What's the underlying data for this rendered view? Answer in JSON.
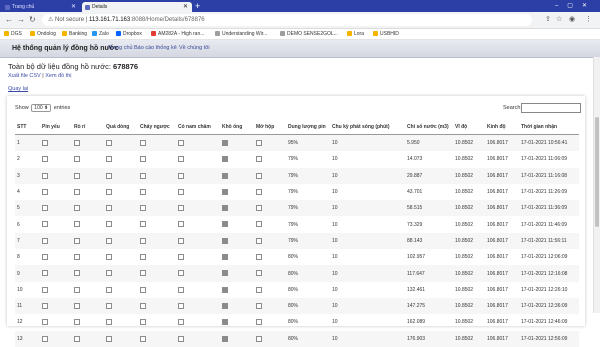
{
  "browser": {
    "tabs": [
      {
        "title": "Trang chủ",
        "active": false
      },
      {
        "title": "Details",
        "active": true
      }
    ],
    "new_tab": "+",
    "url": {
      "security": "Not secure",
      "separator": "|",
      "host": "113.161.71.163",
      "path": ":8088/Home/Details/678876"
    },
    "bookmarks": [
      "DGS",
      "Ondolog",
      "Banking",
      "Zalo",
      "Dropbox",
      "AM282A - High ran...",
      "Understanding Wir...",
      "DEMO SENSE2GOL...",
      "Lora",
      "USBHID"
    ]
  },
  "site_nav": {
    "brand": "Hệ thống quản lý đồng hồ nước",
    "links": [
      "Trang chủ",
      "Báo cáo thống kê",
      "Về chúng tôi"
    ]
  },
  "page": {
    "title_prefix": "Toàn bộ dữ liệu đồng hồ nước: ",
    "meter_id": "678876",
    "export_csv": "Xuất file CSV",
    "actions_sep": " | ",
    "view_chart": "Xem đồ thị",
    "back": "Quay lại"
  },
  "table_controls": {
    "show_label": "Show",
    "entries_value": "100",
    "entries_label": "entries",
    "search_label": "Search:"
  },
  "table": {
    "headers": [
      "STT",
      "Pin yếu",
      "Rò rỉ",
      "Quá dòng",
      "Chảy ngược",
      "Có nam châm",
      "Khô ống",
      "Mở hộp",
      "Dung lượng pin",
      "Chu kỳ phát sóng (phút)",
      "Chỉ số nước (m3)",
      "Vĩ độ",
      "Kinh độ",
      "Thời gian nhận"
    ],
    "rows": [
      {
        "stt": "1",
        "pin_yeu": false,
        "ro_ri": false,
        "qua_dong": false,
        "chay_nguoc": false,
        "nam_cham": false,
        "kho_ong": true,
        "mo_hop": false,
        "pin": "95%",
        "chu_ky": "10",
        "chi_so": "5.950",
        "vi_do": "10.8502",
        "kinh_do": "106.8017",
        "thoi_gian": "17-01-2021 10:56:41"
      },
      {
        "stt": "2",
        "pin_yeu": false,
        "ro_ri": false,
        "qua_dong": false,
        "chay_nguoc": false,
        "nam_cham": false,
        "kho_ong": true,
        "mo_hop": false,
        "pin": "79%",
        "chu_ky": "10",
        "chi_so": "14.073",
        "vi_do": "10.8502",
        "kinh_do": "106.8017",
        "thoi_gian": "17-01-2021 11:06:09"
      },
      {
        "stt": "3",
        "pin_yeu": false,
        "ro_ri": false,
        "qua_dong": false,
        "chay_nguoc": false,
        "nam_cham": false,
        "kho_ong": true,
        "mo_hop": false,
        "pin": "79%",
        "chu_ky": "10",
        "chi_so": "29.887",
        "vi_do": "10.8502",
        "kinh_do": "106.8017",
        "thoi_gian": "17-01-2021 11:16:08"
      },
      {
        "stt": "4",
        "pin_yeu": false,
        "ro_ri": false,
        "qua_dong": false,
        "chay_nguoc": false,
        "nam_cham": false,
        "kho_ong": true,
        "mo_hop": false,
        "pin": "79%",
        "chu_ky": "10",
        "chi_so": "43.701",
        "vi_do": "10.8502",
        "kinh_do": "106.8017",
        "thoi_gian": "17-01-2021 11:26:09"
      },
      {
        "stt": "5",
        "pin_yeu": false,
        "ro_ri": false,
        "qua_dong": false,
        "chay_nguoc": false,
        "nam_cham": false,
        "kho_ong": true,
        "mo_hop": false,
        "pin": "79%",
        "chu_ky": "10",
        "chi_so": "58.515",
        "vi_do": "10.8502",
        "kinh_do": "106.8017",
        "thoi_gian": "17-01-2021 11:36:09"
      },
      {
        "stt": "6",
        "pin_yeu": false,
        "ro_ri": false,
        "qua_dong": false,
        "chay_nguoc": false,
        "nam_cham": false,
        "kho_ong": true,
        "mo_hop": false,
        "pin": "79%",
        "chu_ky": "10",
        "chi_so": "73.329",
        "vi_do": "10.8502",
        "kinh_do": "106.8017",
        "thoi_gian": "17-01-2021 11:46:09"
      },
      {
        "stt": "7",
        "pin_yeu": false,
        "ro_ri": false,
        "qua_dong": false,
        "chay_nguoc": false,
        "nam_cham": false,
        "kho_ong": true,
        "mo_hop": false,
        "pin": "79%",
        "chu_ky": "10",
        "chi_so": "88.143",
        "vi_do": "10.8502",
        "kinh_do": "106.8017",
        "thoi_gian": "17-01-2021 11:56:11"
      },
      {
        "stt": "8",
        "pin_yeu": false,
        "ro_ri": false,
        "qua_dong": false,
        "chay_nguoc": false,
        "nam_cham": false,
        "kho_ong": true,
        "mo_hop": false,
        "pin": "80%",
        "chu_ky": "10",
        "chi_so": "102.957",
        "vi_do": "10.8502",
        "kinh_do": "106.8017",
        "thoi_gian": "17-01-2021 12:06:09"
      },
      {
        "stt": "9",
        "pin_yeu": false,
        "ro_ri": false,
        "qua_dong": false,
        "chay_nguoc": false,
        "nam_cham": false,
        "kho_ong": true,
        "mo_hop": false,
        "pin": "80%",
        "chu_ky": "10",
        "chi_so": "117.647",
        "vi_do": "10.8502",
        "kinh_do": "106.8017",
        "thoi_gian": "17-01-2021 12:16:08"
      },
      {
        "stt": "10",
        "pin_yeu": false,
        "ro_ri": false,
        "qua_dong": false,
        "chay_nguoc": false,
        "nam_cham": false,
        "kho_ong": true,
        "mo_hop": false,
        "pin": "80%",
        "chu_ky": "10",
        "chi_so": "132.461",
        "vi_do": "10.8502",
        "kinh_do": "106.8017",
        "thoi_gian": "17-01-2021 12:26:10"
      },
      {
        "stt": "11",
        "pin_yeu": false,
        "ro_ri": false,
        "qua_dong": false,
        "chay_nguoc": false,
        "nam_cham": false,
        "kho_ong": true,
        "mo_hop": false,
        "pin": "80%",
        "chu_ky": "10",
        "chi_so": "147.275",
        "vi_do": "10.8502",
        "kinh_do": "106.8017",
        "thoi_gian": "17-01-2021 12:36:09"
      },
      {
        "stt": "12",
        "pin_yeu": false,
        "ro_ri": false,
        "qua_dong": false,
        "chay_nguoc": false,
        "nam_cham": false,
        "kho_ong": true,
        "mo_hop": false,
        "pin": "80%",
        "chu_ky": "10",
        "chi_so": "162.089",
        "vi_do": "10.8502",
        "kinh_do": "106.8017",
        "thoi_gian": "17-01-2021 12:46:09"
      },
      {
        "stt": "13",
        "pin_yeu": false,
        "ro_ri": false,
        "qua_dong": false,
        "chay_nguoc": false,
        "nam_cham": false,
        "kho_ong": true,
        "mo_hop": false,
        "pin": "80%",
        "chu_ky": "10",
        "chi_so": "176.903",
        "vi_do": "10.8502",
        "kinh_do": "106.8017",
        "thoi_gian": "17-01-2021 12:56:09"
      }
    ]
  },
  "colors": {
    "tab_bar": "#2b3fa6",
    "link": "#3a4aa8",
    "checkbox_checked": "#8a8a8a"
  }
}
